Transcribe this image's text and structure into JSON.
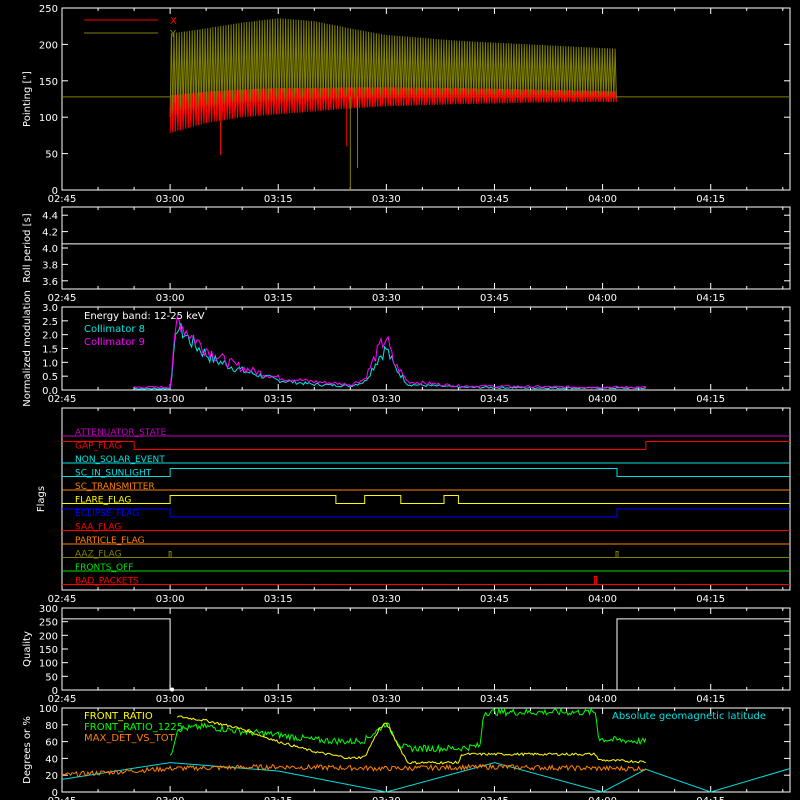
{
  "time_ticks": [
    "02:45",
    "03:00",
    "03:15",
    "03:30",
    "03:45",
    "04:00",
    "04:15"
  ],
  "colors": {
    "frame": "#ffffff",
    "x_series": "#ff0000",
    "y_series": "#808000",
    "collimator8": "#00e5e5",
    "collimator9": "#ff00ff",
    "energy": "#ffffff",
    "front_ratio": "#ffff00",
    "front_ratio_1225": "#00ff00",
    "max_det": "#ff8000",
    "geomag": "#00e0e0"
  },
  "chart_data": [
    {
      "type": "line",
      "ylabel": "Pointing [\"]",
      "ylim": [
        0,
        250
      ],
      "yticks": [
        "0",
        "50",
        "100",
        "150",
        "200",
        "250"
      ],
      "xlim": [
        "02:45",
        "04:26"
      ],
      "legend": [
        "X",
        "Y"
      ],
      "reference_line": 128,
      "series": [
        {
          "name": "X",
          "x": [
            "03:00",
            "03:05",
            "03:10",
            "03:15",
            "03:20",
            "03:25",
            "03:30",
            "03:40",
            "03:50",
            "04:00",
            "04:02"
          ],
          "low": [
            78,
            92,
            100,
            104,
            108,
            112,
            115,
            118,
            120,
            121,
            121
          ],
          "high": [
            130,
            135,
            138,
            140,
            140,
            141,
            141,
            140,
            138,
            136,
            135
          ]
        },
        {
          "name": "Y",
          "x": [
            "03:00",
            "03:05",
            "03:10",
            "03:15",
            "03:20",
            "03:25",
            "03:30",
            "03:40",
            "03:50",
            "04:00",
            "04:02"
          ],
          "low": [
            100,
            102,
            105,
            108,
            112,
            114,
            116,
            120,
            122,
            124,
            124
          ],
          "high": [
            215,
            222,
            230,
            236,
            232,
            222,
            213,
            205,
            200,
            195,
            194
          ]
        }
      ]
    },
    {
      "type": "line",
      "ylabel": "Roll period [s]",
      "ylim": [
        3.5,
        4.5
      ],
      "yticks": [
        "3.6",
        "3.8",
        "4.0",
        "4.2",
        "4.4"
      ],
      "series": [
        {
          "name": "",
          "x": [
            "02:45",
            "04:26"
          ],
          "values": [
            4.05,
            4.05
          ]
        }
      ]
    },
    {
      "type": "line",
      "ylabel": "Normalized modulation",
      "ylim": [
        0,
        3.0
      ],
      "yticks": [
        "0.0",
        "0.5",
        "1.0",
        "1.5",
        "2.0",
        "2.5",
        "3.0"
      ],
      "annotation": "Energy band: 12-25 keV",
      "legend": [
        "Collimator 8",
        "Collimator 9"
      ],
      "series": [
        {
          "name": "Collimator 8",
          "x": [
            "02:55",
            "03:00",
            "03:01",
            "03:02",
            "03:04",
            "03:06",
            "03:08",
            "03:10",
            "03:15",
            "03:20",
            "03:25",
            "03:27",
            "03:29",
            "03:30",
            "03:31",
            "03:33",
            "03:40",
            "03:50",
            "04:00",
            "04:06"
          ],
          "values": [
            0.05,
            0.05,
            2.3,
            2.0,
            1.5,
            1.1,
            0.9,
            0.7,
            0.35,
            0.2,
            0.15,
            0.3,
            1.2,
            1.5,
            0.9,
            0.2,
            0.1,
            0.08,
            0.07,
            0.07
          ]
        },
        {
          "name": "Collimator 9",
          "x": [
            "02:55",
            "03:00",
            "03:01",
            "03:02",
            "03:04",
            "03:06",
            "03:08",
            "03:10",
            "03:15",
            "03:20",
            "03:25",
            "03:27",
            "03:29",
            "03:30",
            "03:31",
            "03:33",
            "03:40",
            "03:50",
            "04:00",
            "04:06"
          ],
          "values": [
            0.1,
            0.1,
            2.6,
            2.2,
            1.7,
            1.3,
            1.0,
            0.8,
            0.45,
            0.3,
            0.2,
            0.4,
            1.5,
            1.9,
            1.0,
            0.3,
            0.15,
            0.12,
            0.1,
            0.1
          ]
        }
      ]
    },
    {
      "type": "line",
      "ylabel": "Flags",
      "flags": [
        {
          "name": "ATTENUATOR_STATE",
          "color": "#c000c0",
          "segments": []
        },
        {
          "name": "GAP_FLAG",
          "color": "#ff0000",
          "segments": [
            [
              "02:45",
              "02:55",
              1
            ],
            [
              "02:55",
              "04:06",
              0
            ],
            [
              "04:06",
              "04:26",
              1
            ]
          ]
        },
        {
          "name": "NON_SOLAR_EVENT",
          "color": "#00e0e0",
          "segments": []
        },
        {
          "name": "SC_IN_SUNLIGHT",
          "color": "#00e0e0",
          "segments": [
            [
              "02:45",
              "03:00",
              0
            ],
            [
              "03:00",
              "04:02",
              1
            ],
            [
              "04:02",
              "04:26",
              0
            ]
          ]
        },
        {
          "name": "SC_TRANSMITTER",
          "color": "#ff8000",
          "segments": []
        },
        {
          "name": "FLARE_FLAG",
          "color": "#ffff00",
          "segments": [
            [
              "02:45",
              "03:00",
              0
            ],
            [
              "03:00",
              "03:23",
              1
            ],
            [
              "03:23",
              "03:27",
              0
            ],
            [
              "03:27",
              "03:32",
              1
            ],
            [
              "03:32",
              "03:38",
              0
            ],
            [
              "03:38",
              "03:40",
              1
            ],
            [
              "03:40",
              "04:26",
              0
            ]
          ]
        },
        {
          "name": "ECLIPSE_FLAG",
          "color": "#0000ff",
          "segments": [
            [
              "02:45",
              "03:00",
              1
            ],
            [
              "03:00",
              "04:02",
              0
            ],
            [
              "04:02",
              "04:26",
              1
            ]
          ]
        },
        {
          "name": "SAA_FLAG",
          "color": "#ff0000",
          "segments": []
        },
        {
          "name": "PARTICLE_FLAG",
          "color": "#ff8000",
          "segments": []
        },
        {
          "name": "AAZ_FLAG",
          "color": "#808000",
          "spikes": [
            "03:00",
            "04:02"
          ]
        },
        {
          "name": "FRONTS_OFF",
          "color": "#00e000",
          "segments": []
        },
        {
          "name": "BAD_PACKETS",
          "color": "#ff0000",
          "spikes": [
            "03:59"
          ]
        }
      ]
    },
    {
      "type": "line",
      "ylabel": "Quality",
      "ylim": [
        0,
        300
      ],
      "yticks": [
        "0",
        "50",
        "100",
        "150",
        "200",
        "250",
        "300"
      ],
      "series": [
        {
          "name": "",
          "x": [
            "02:45",
            "03:00",
            "03:00",
            "04:02",
            "04:02",
            "04:26"
          ],
          "values": [
            260,
            260,
            0,
            0,
            260,
            260
          ]
        }
      ]
    },
    {
      "type": "line",
      "ylabel": "Degrees or %",
      "ylim": [
        0,
        100
      ],
      "yticks": [
        "0",
        "20",
        "40",
        "60",
        "80",
        "100"
      ],
      "legend": [
        "FRONT_RATIO",
        "FRONT_RATIO_1225",
        "MAX_DET_VS_TOT"
      ],
      "annotation": "Absolute geomagnetic latitude",
      "series": [
        {
          "name": "FRONT_RATIO",
          "x": [
            "03:01",
            "03:05",
            "03:10",
            "03:15",
            "03:20",
            "03:25",
            "03:27",
            "03:29",
            "03:30",
            "03:32",
            "03:33",
            "03:40",
            "03:40.5",
            "03:50",
            "03:59",
            "03:59.5",
            "04:06"
          ],
          "values": [
            90,
            85,
            75,
            60,
            48,
            40,
            42,
            75,
            82,
            50,
            35,
            35,
            45,
            45,
            45,
            38,
            36
          ]
        },
        {
          "name": "FRONT_RATIO_1225",
          "x": [
            "03:00",
            "03:01",
            "03:05",
            "03:10",
            "03:15",
            "03:20",
            "03:25",
            "03:27",
            "03:29",
            "03:30",
            "03:32",
            "03:33",
            "03:40",
            "03:43",
            "03:43.5",
            "03:59",
            "03:59.5",
            "04:06"
          ],
          "values": [
            40,
            75,
            78,
            72,
            68,
            62,
            60,
            62,
            75,
            82,
            55,
            52,
            52,
            55,
            95,
            95,
            63,
            60
          ]
        },
        {
          "name": "MAX_DET_VS_TOT",
          "x": [
            "02:45",
            "03:00",
            "03:15",
            "03:30",
            "03:45",
            "04:00",
            "04:06"
          ],
          "values": [
            20,
            28,
            30,
            28,
            30,
            28,
            28
          ]
        },
        {
          "name": "Absolute geomagnetic latitude",
          "x": [
            "02:45",
            "03:00",
            "03:15",
            "03:30",
            "03:45",
            "04:00",
            "04:06",
            "04:15",
            "04:26"
          ],
          "values": [
            15,
            35,
            25,
            0,
            35,
            0,
            27,
            0,
            28
          ]
        }
      ]
    }
  ]
}
